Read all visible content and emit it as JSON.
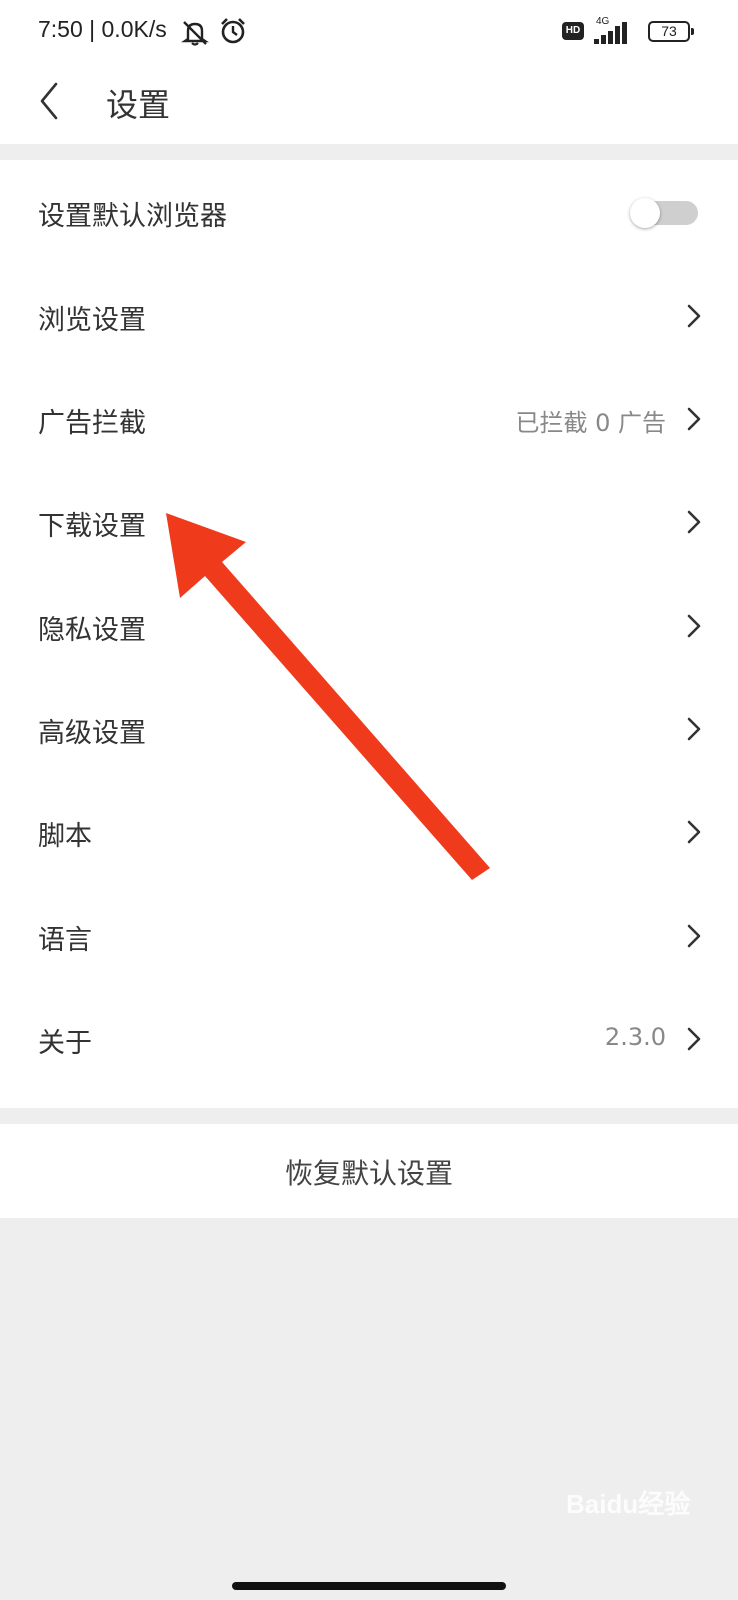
{
  "status_bar": {
    "time_speed": "7:50 | 0.0K/s",
    "hd_badge": "HD",
    "network_label": "4G",
    "battery": "73",
    "icons": [
      "mute-icon",
      "alarm-icon",
      "signal-icon"
    ]
  },
  "header": {
    "title": "设置",
    "back_icon": "chevron-left-icon"
  },
  "settings": {
    "items": [
      {
        "label": "设置默认浏览器",
        "control": "toggle",
        "toggle_on": false
      },
      {
        "label": "浏览设置",
        "control": "chevron"
      },
      {
        "label": "广告拦截",
        "value": "已拦截 0 广告",
        "control": "chevron"
      },
      {
        "label": "下载设置",
        "control": "chevron"
      },
      {
        "label": "隐私设置",
        "control": "chevron"
      },
      {
        "label": "高级设置",
        "control": "chevron"
      },
      {
        "label": "脚本",
        "control": "chevron"
      },
      {
        "label": "语言",
        "control": "chevron"
      },
      {
        "label": "关于",
        "value": "2.3.0",
        "control": "chevron"
      }
    ]
  },
  "restore_button": {
    "label": "恢复默认设置"
  },
  "annotation": {
    "color": "#f03a1c",
    "points_to": "下载设置"
  },
  "watermark": "Baidu经验",
  "colors": {
    "background": "#eeeeee",
    "surface": "#ffffff",
    "text": "#333333",
    "secondary_text": "#888888"
  }
}
